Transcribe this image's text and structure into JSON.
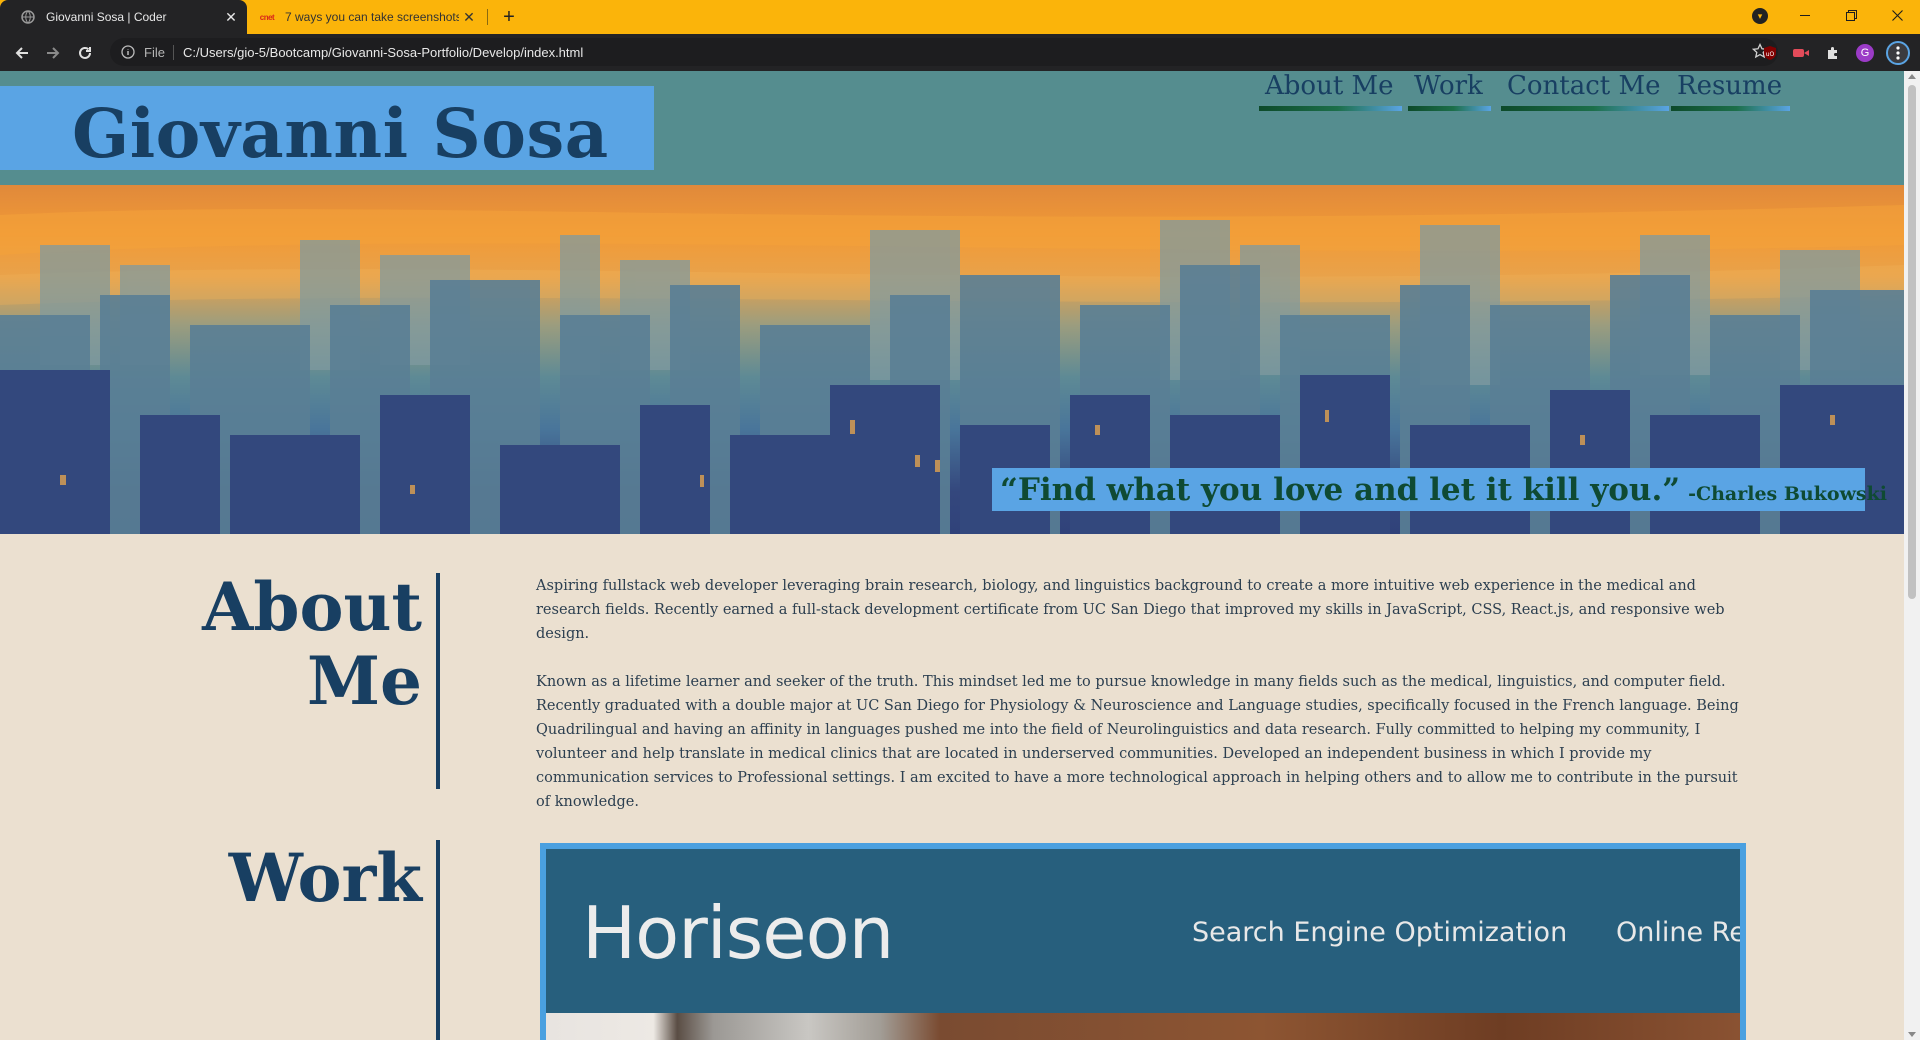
{
  "browser": {
    "tabs": [
      {
        "title": "Giovanni Sosa | Coder",
        "active": true
      },
      {
        "title": "7 ways you can take screenshots",
        "active": false,
        "favicon_text": "cnet"
      }
    ],
    "address": {
      "scheme": "File",
      "url": "C:/Users/gio-5/Bootcamp/Giovanni-Sosa-Portfolio/Develop/index.html"
    },
    "profile_initial": "G",
    "accent_color": "#fbb40a"
  },
  "site": {
    "logo": "Giovanni Sosa",
    "nav": [
      "About Me",
      "Work",
      "Contact Me",
      "Resume"
    ],
    "hero": {
      "quote": "“Find what you love and let it kill you.”",
      "author": "-Charles Bukowski"
    },
    "about": {
      "title_line1": "About",
      "title_line2": "Me",
      "paragraphs": [
        "Aspiring fullstack web developer leveraging brain research, biology, and linguistics background to create a more intuitive web experience in the medical and research fields. Recently earned a full-stack development certificate from UC San Diego that improved my skills in JavaScript, CSS, React.js, and responsive web design.",
        "Known as a lifetime learner and seeker of the truth. This mindset led me to pursue knowledge in many fields such as the medical, linguistics, and computer field. Recently graduated with a double major at UC San Diego for Physiology & Neuroscience and Language studies, specifically focused in the French language. Being Quadrilingual and having an affinity in languages pushed me into the field of Neurolinguistics and data research. Fully committed to helping my community, I volunteer and help translate in medical clinics that are located in underserved communities. Developed an independent business in which I provide my communication services to Professional settings. I am excited to have a more technological approach in helping others and to allow me to contribute in the pursuit of knowledge."
      ]
    },
    "work": {
      "title": "Work",
      "project": {
        "logo": "Horiseon",
        "nav": [
          "Search Engine Optimization",
          "Online Re"
        ]
      }
    },
    "colors": {
      "header_bg": "#558d8f",
      "logo_bg": "#5aa4e4",
      "navy": "#183f62",
      "page_bg": "#ebe0d0",
      "quote_green": "#0f4a33"
    }
  }
}
